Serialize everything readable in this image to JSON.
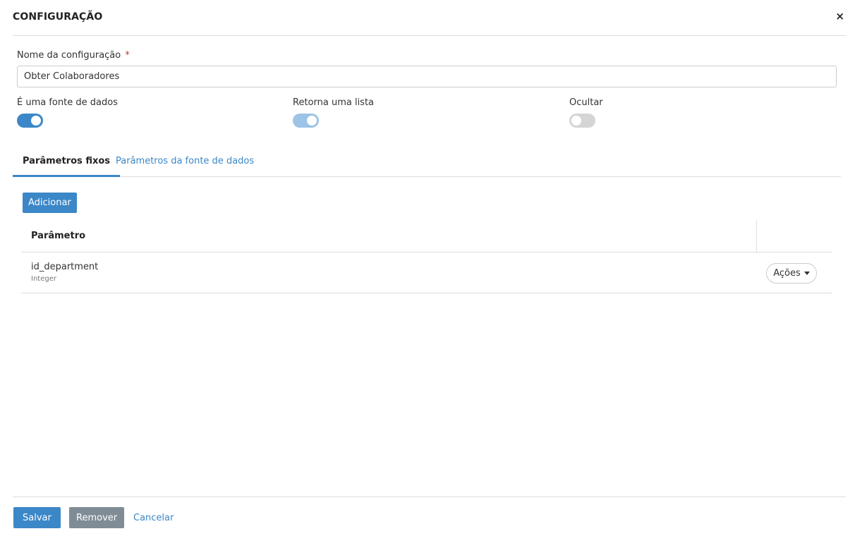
{
  "header": {
    "title": "CONFIGURAÇÃO",
    "close_glyph": "×"
  },
  "form": {
    "name_label": "Nome da configuração",
    "required_mark": "*",
    "name_value": "Obter Colaboradores"
  },
  "toggles": [
    {
      "label": "É uma fonte de dados",
      "on": true,
      "color": "#3b87c8"
    },
    {
      "label": "Retorna uma lista",
      "on": true,
      "color": "#9dc3e6"
    },
    {
      "label": "Ocultar",
      "on": false,
      "color": "#d5d5d5"
    }
  ],
  "tabs": [
    {
      "label": "Parâmetros fixos",
      "active": true
    },
    {
      "label": "Parâmetros da fonte de dados",
      "active": false
    }
  ],
  "add_button": "Adicionar",
  "table": {
    "column_param": "Parâmetro",
    "rows": [
      {
        "name": "id_department",
        "type": "Integer",
        "actions_label": "Ações"
      }
    ]
  },
  "footer": {
    "save": "Salvar",
    "remove": "Remover",
    "cancel": "Cancelar"
  },
  "colors": {
    "accent": "#3b87c8",
    "secondary_button": "#7f8c95",
    "required": "#c0392b"
  },
  "icons": {
    "close": "close-icon",
    "caret": "caret-down-icon"
  }
}
